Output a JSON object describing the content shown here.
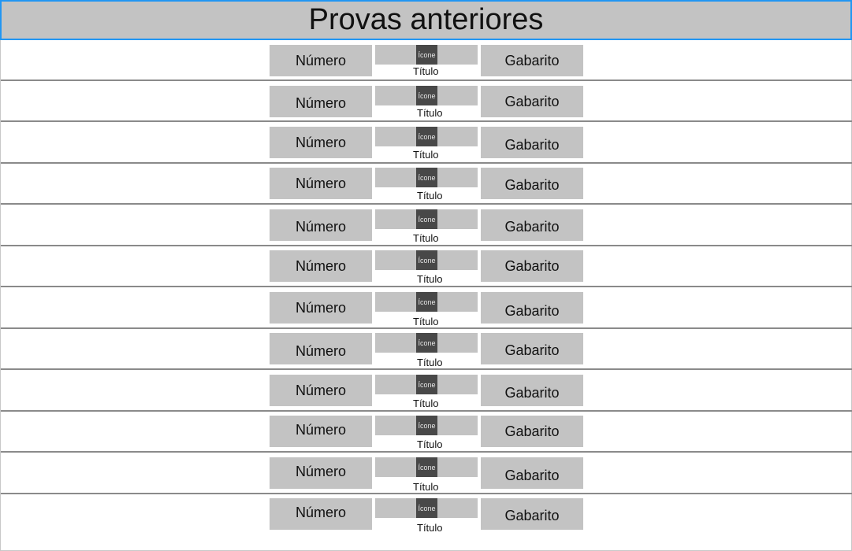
{
  "header": {
    "title": "Provas anteriores"
  },
  "rows": [
    {
      "numero": "Número",
      "icone": "Ícone",
      "titulo": "Título",
      "gabarito": "Gabarito"
    },
    {
      "numero": "Número",
      "icone": "Ícone",
      "titulo": "Título",
      "gabarito": "Gabarito"
    },
    {
      "numero": "Número",
      "icone": "Ícone",
      "titulo": "Título",
      "gabarito": "Gabarito"
    },
    {
      "numero": "Número",
      "icone": "Ícone",
      "titulo": "Título",
      "gabarito": "Gabarito"
    },
    {
      "numero": "Número",
      "icone": "Ícone",
      "titulo": "Título",
      "gabarito": "Gabarito"
    },
    {
      "numero": "Número",
      "icone": "Ícone",
      "titulo": "Título",
      "gabarito": "Gabarito"
    },
    {
      "numero": "Número",
      "icone": "Ícone",
      "titulo": "Título",
      "gabarito": "Gabarito"
    },
    {
      "numero": "Número",
      "icone": "Ícone",
      "titulo": "Título",
      "gabarito": "Gabarito"
    },
    {
      "numero": "Número",
      "icone": "Ícone",
      "titulo": "Título",
      "gabarito": "Gabarito"
    },
    {
      "numero": "Número",
      "icone": "Ícone",
      "titulo": "Título",
      "gabarito": "Gabarito"
    },
    {
      "numero": "Número",
      "icone": "Ícone",
      "titulo": "Título",
      "gabarito": "Gabarito"
    },
    {
      "numero": "Número",
      "icone": "Ícone",
      "titulo": "Título",
      "gabarito": "Gabarito"
    }
  ]
}
